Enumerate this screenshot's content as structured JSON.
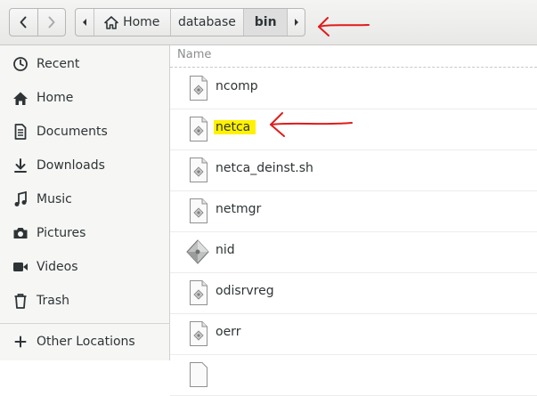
{
  "pathbar": {
    "segments": [
      "Home",
      "database",
      "bin"
    ]
  },
  "sidebar": {
    "items": [
      {
        "label": "Recent",
        "icon": "clock-icon"
      },
      {
        "label": "Home",
        "icon": "home-icon"
      },
      {
        "label": "Documents",
        "icon": "document-icon"
      },
      {
        "label": "Downloads",
        "icon": "download-icon"
      },
      {
        "label": "Music",
        "icon": "music-icon"
      },
      {
        "label": "Pictures",
        "icon": "camera-icon"
      },
      {
        "label": "Videos",
        "icon": "video-icon"
      },
      {
        "label": "Trash",
        "icon": "trash-icon"
      },
      {
        "label": "Other Locations",
        "icon": "plus-icon"
      }
    ]
  },
  "filelist": {
    "column_header": "Name",
    "files": [
      {
        "name": "ncomp",
        "icon": "executable-file-icon"
      },
      {
        "name": "netca",
        "icon": "executable-file-icon",
        "highlighted": true
      },
      {
        "name": "netca_deinst.sh",
        "icon": "executable-file-icon"
      },
      {
        "name": "netmgr",
        "icon": "executable-file-icon"
      },
      {
        "name": "nid",
        "icon": "binary-executable-icon"
      },
      {
        "name": "odisrvreg",
        "icon": "executable-file-icon"
      },
      {
        "name": "oerr",
        "icon": "executable-file-icon"
      }
    ]
  },
  "colors": {
    "highlight": "#fff200",
    "annotation_arrow": "#e01b1b"
  }
}
